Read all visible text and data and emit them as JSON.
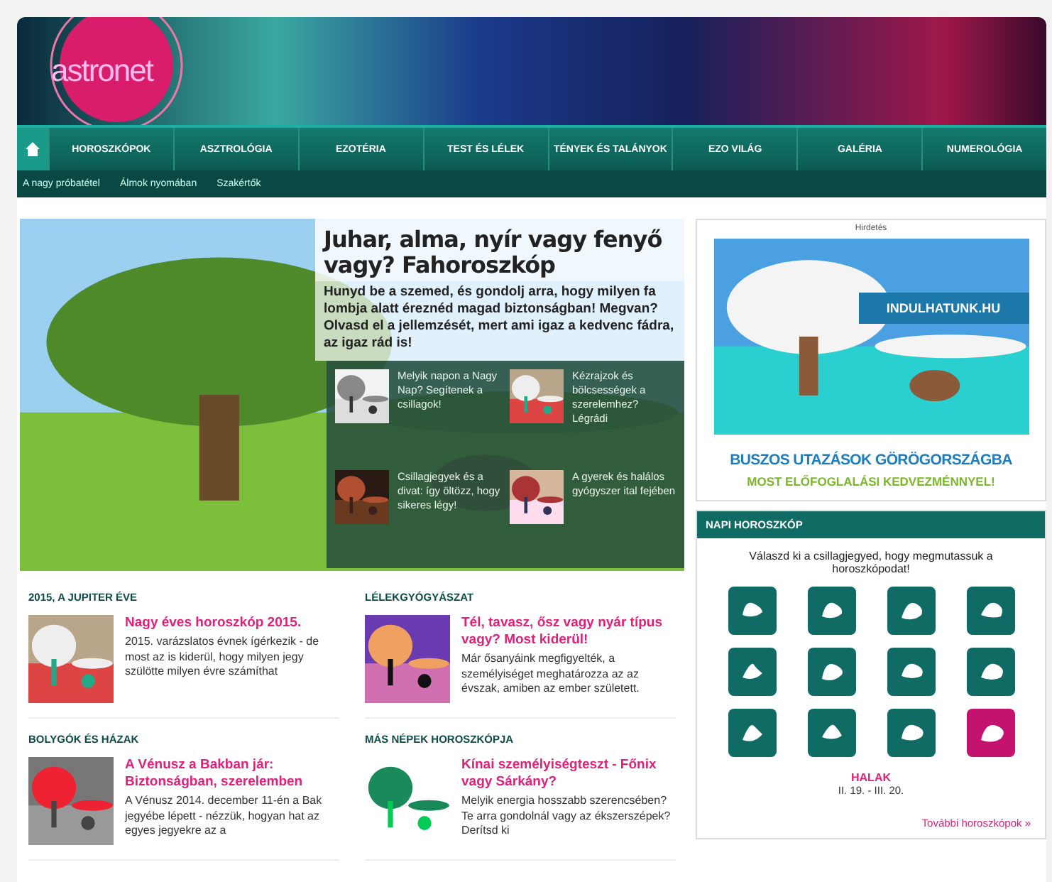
{
  "site": {
    "logo": "astronet"
  },
  "nav": {
    "items": [
      {
        "label": "HOROSZKÓPOK"
      },
      {
        "label": "ASZTROLÓGIA"
      },
      {
        "label": "EZOTÉRIA"
      },
      {
        "label": "TEST ÉS LÉLEK"
      },
      {
        "label": "TÉNYEK ÉS TALÁNYOK"
      },
      {
        "label": "EZO VILÁG"
      },
      {
        "label": "GALÉRIA"
      },
      {
        "label": "NUMEROLÓGIA"
      }
    ]
  },
  "subnav": {
    "items": [
      "A nagy próbatétel",
      "Álmok nyomában",
      "Szakértők"
    ]
  },
  "hero": {
    "title": "Juhar, alma, nyír vagy fenyő vagy? Fahoroszkóp",
    "text": "Hunyd be a szemed, és gondolj arra, hogy milyen fa lombja alatt éreznéd magad biztonságban! Megvan? Olvasd el a jellemzését, mert ami igaz a kedvenc fádra, az igaz rád is!",
    "links": [
      {
        "text": "Melyik napon a Nagy Nap? Segítenek a csillagok!"
      },
      {
        "text": "Kézrajzok és bölcsességek a szerelemhez? Légrádi"
      },
      {
        "text": "Csillagjegyek és a divat: így öltözz, hogy sikeres légy!"
      },
      {
        "text": "A gyerek és halálos gyógyszer ital fejében"
      }
    ]
  },
  "sections": [
    {
      "heading": "2015, A JUPITER ÉVE",
      "title": "Nagy éves horoszkóp 2015.",
      "text": "2015. varázslatos évnek ígérkezik - de most az is kiderül, hogy milyen jegy szülötte milyen évre számíthat"
    },
    {
      "heading": "LÉLEKGYÓGYÁSZAT",
      "title": "Tél, tavasz, ősz vagy nyár típus vagy? Most kiderül!",
      "text": "Már ősanyáink megfigyelték, a személyiséget meghatározza az az évszak, amiben az ember született."
    },
    {
      "heading": "BOLYGÓK ÉS HÁZAK",
      "title": "A Vénusz a Bakban jár: Biztonságban, szerelemben",
      "text": "A Vénusz 2014. december 11-én a Bak jegyébe lépett - nézzük, hogyan hat az egyes jegyekre az a"
    },
    {
      "heading": "MÁS NÉPEK HOROSZKÓPJA",
      "title": "Kínai személyiségteszt - Főnix vagy Sárkány?",
      "text": "Melyik energia hosszabb szerencsében? Te arra gondolnál vagy az ékszerszépek? Derítsd ki"
    }
  ],
  "ad": {
    "label": "Hirdetés",
    "brand": "INDULHATUNK.HU",
    "headline": "BUSZOS UTAZÁSOK GÖRÖGORSZÁGBA",
    "subline": "MOST ELŐFOGLALÁSI KEDVEZMÉNNYEL!"
  },
  "daily": {
    "title": "NAPI HOROSZKÓP",
    "prompt": "Válaszd ki a csillagjegyed, hogy megmutassuk a horoszkópodat!",
    "signs": [
      {
        "selected": false
      },
      {
        "selected": false
      },
      {
        "selected": false
      },
      {
        "selected": false
      },
      {
        "selected": false
      },
      {
        "selected": false
      },
      {
        "selected": false
      },
      {
        "selected": false
      },
      {
        "selected": false
      },
      {
        "selected": false
      },
      {
        "selected": false
      },
      {
        "selected": true
      }
    ],
    "sign_name": "HALAK",
    "sign_dates": "II. 19. - III. 20.",
    "more": "További horoszkópok »"
  }
}
